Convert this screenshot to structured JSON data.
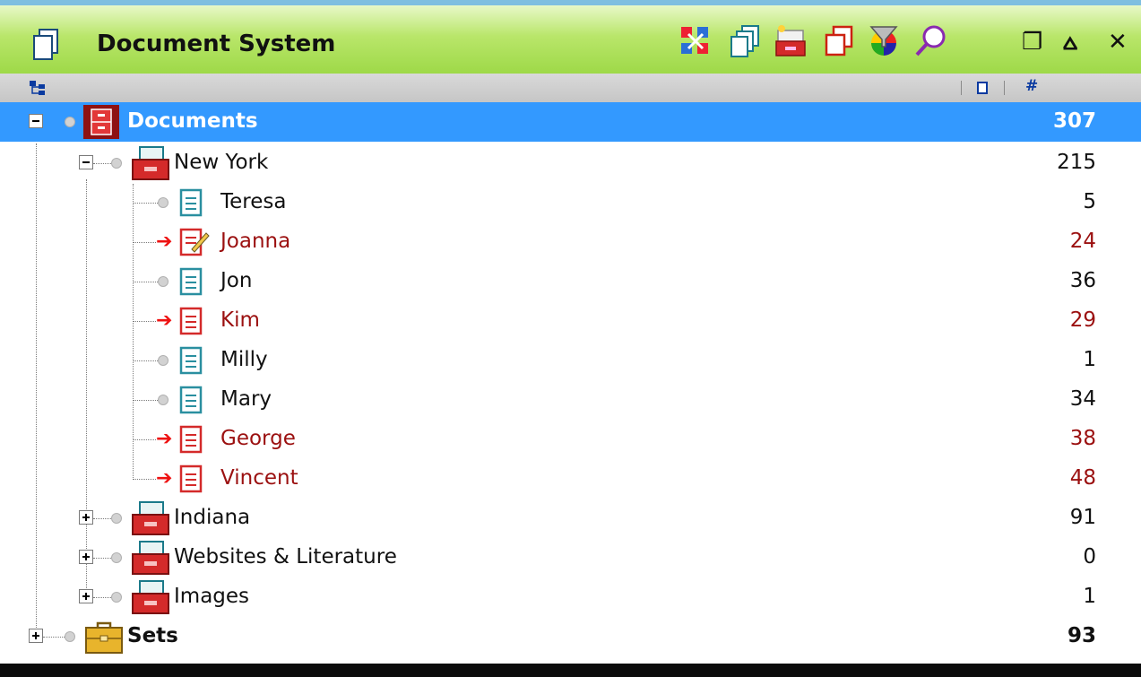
{
  "window": {
    "title": "Document System",
    "toolbar_icons": [
      "close-all-icon",
      "copy-window-icon",
      "new-folder-icon",
      "duplicate-icon",
      "filter-color-icon",
      "search-icon"
    ],
    "controls": [
      "float-window-icon",
      "minimize-window-icon",
      "close-window-icon"
    ]
  },
  "header": {
    "tree_icon": "tree-view-icon",
    "col_icon": "document-column-icon",
    "col_hash": "#"
  },
  "tree": {
    "root": {
      "label": "Documents",
      "count": "307",
      "icon": "cabinet-icon",
      "selected": true,
      "expanded": true
    },
    "groups": [
      {
        "label": "New York",
        "count": "215",
        "icon": "drawer-icon",
        "expanded": true,
        "children": [
          {
            "label": "Teresa",
            "count": "5",
            "icon": "document-icon",
            "flagged": false
          },
          {
            "label": "Joanna",
            "count": "24",
            "icon": "document-edit-icon",
            "flagged": true
          },
          {
            "label": "Jon",
            "count": "36",
            "icon": "document-icon",
            "flagged": false
          },
          {
            "label": "Kim",
            "count": "29",
            "icon": "document-icon",
            "flagged": true
          },
          {
            "label": "Milly",
            "count": "1",
            "icon": "document-icon",
            "flagged": false
          },
          {
            "label": "Mary",
            "count": "34",
            "icon": "document-icon",
            "flagged": false
          },
          {
            "label": "George",
            "count": "38",
            "icon": "document-icon",
            "flagged": true
          },
          {
            "label": "Vincent",
            "count": "48",
            "icon": "document-icon",
            "flagged": true
          }
        ]
      },
      {
        "label": "Indiana",
        "count": "91",
        "icon": "drawer-icon",
        "expanded": false
      },
      {
        "label": "Websites & Literature",
        "count": "0",
        "icon": "drawer-icon",
        "expanded": false
      },
      {
        "label": "Images",
        "count": "1",
        "icon": "drawer-icon",
        "expanded": false
      }
    ],
    "sets": {
      "label": "Sets",
      "count": "93",
      "icon": "briefcase-icon",
      "expanded": false
    }
  },
  "colors": {
    "titlebar": "#a5dc4f",
    "selection": "#3399ff",
    "flagged_text": "#9b1010",
    "arrow": "#e11111"
  }
}
